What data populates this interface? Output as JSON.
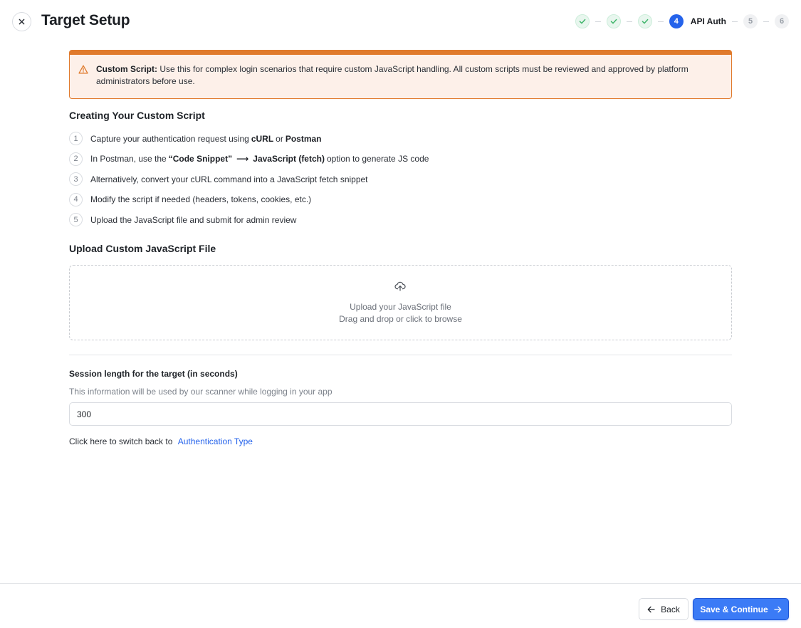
{
  "header": {
    "title": "Target Setup",
    "close_icon": "close-icon"
  },
  "stepper": {
    "completed_steps": 3,
    "active": {
      "number": "4",
      "label": "API Auth"
    },
    "pending": [
      "5",
      "6"
    ],
    "colors": {
      "done_bg": "#e8f6ee",
      "done_check": "#3fb56b",
      "active": "#2563eb"
    }
  },
  "alert": {
    "icon": "warning-triangle-icon",
    "title": "Custom Script:",
    "message": "Use this for complex login scenarios that require custom JavaScript handling. All custom scripts must be reviewed and approved by platform administrators before use.",
    "color": "#e07a2c"
  },
  "instructions": {
    "title": "Creating Your Custom Script",
    "steps": [
      {
        "num": "1",
        "pre": "Capture your authentication request using",
        "b1": "cURL",
        "mid": "or",
        "b2": "Postman"
      },
      {
        "num": "2",
        "pre": "In Postman, use the",
        "b1": "“Code Snippet”",
        "arrow": "⟶",
        "b2": "JavaScript (fetch)",
        "post": "option to generate JS code"
      },
      {
        "num": "3",
        "text": "Alternatively, convert your cURL command into a JavaScript fetch snippet"
      },
      {
        "num": "4",
        "text": "Modify the script if needed (headers, tokens, cookies, etc.)"
      },
      {
        "num": "5",
        "text": "Upload the JavaScript file and submit for admin review"
      }
    ]
  },
  "upload": {
    "title": "Upload Custom JavaScript File",
    "icon": "cloud-upload-icon",
    "dropzone_title": "Upload your JavaScript file",
    "dropzone_sub": "Drag and drop or click to browse"
  },
  "session": {
    "label": "Session length for the target (in seconds)",
    "help": "This information will be used by our scanner while logging in your app",
    "value": "300"
  },
  "switch_back": {
    "text": "Click here to switch back to",
    "link": "Authentication Type"
  },
  "footer": {
    "back_label": "Back",
    "save_label": "Save & Continue",
    "primary_color": "#3b7bf6"
  }
}
